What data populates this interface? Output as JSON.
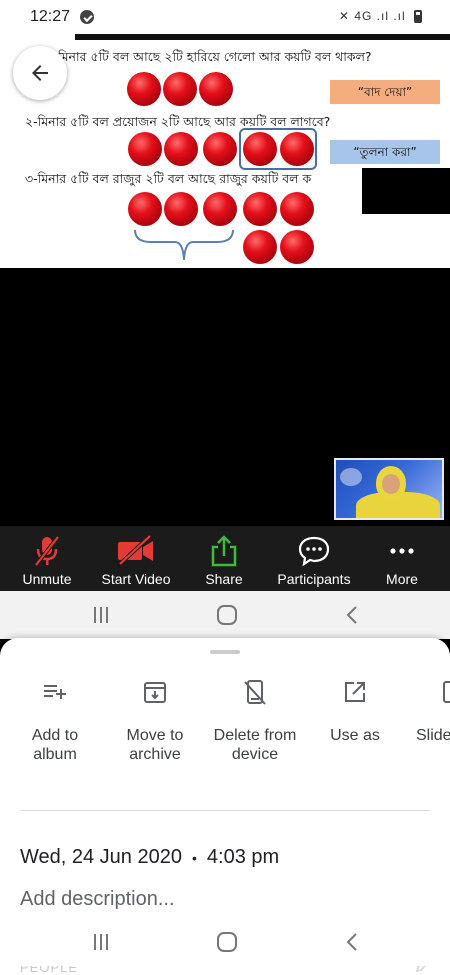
{
  "status_bar": {
    "time": "12:27",
    "system_icons_text": "4G .ıl .ıl"
  },
  "slide": {
    "question_1": "মিনার ৫টি বল আছে ২টি হারিয়ে গেলো আর কয়টি বল থাকল?",
    "question_2": "২-মিনার ৫টি বল প্রয়োজন ২টি আছে আর কয়টি বল লাগবে?",
    "question_3": "৩-মিনার ৫টি বল রাজুর ২টি বল আছে রাজুর কয়টি বল ক",
    "tag_1": "“বাদ দেয়া”",
    "tag_2": "“তুলনা করা”",
    "colors": {
      "ball": "#e3101a",
      "tag_1_bg": "#f4ad7e",
      "tag_2_bg": "#a7c4ea",
      "outline": "#4a6da3"
    }
  },
  "zoom_toolbar": {
    "unmute": "Unmute",
    "start_video": "Start Video",
    "share": "Share",
    "participants": "Participants",
    "more": "More",
    "colors": {
      "muted_red": "#e53935",
      "share_green": "#3dbb3d"
    }
  },
  "sheet": {
    "actions": [
      {
        "label": "Add to album",
        "icon": "playlist-add-icon"
      },
      {
        "label": "Move to archive",
        "icon": "archive-icon"
      },
      {
        "label": "Delete from device",
        "icon": "delete-from-device-icon"
      },
      {
        "label": "Use as",
        "icon": "open-in-new-icon"
      },
      {
        "label": "Slide",
        "icon": "slideshow-icon"
      }
    ],
    "date": "Wed, 24 Jun 2020",
    "time": "4:03 pm",
    "description_placeholder": "Add description...",
    "people_header": "PEOPLE"
  }
}
